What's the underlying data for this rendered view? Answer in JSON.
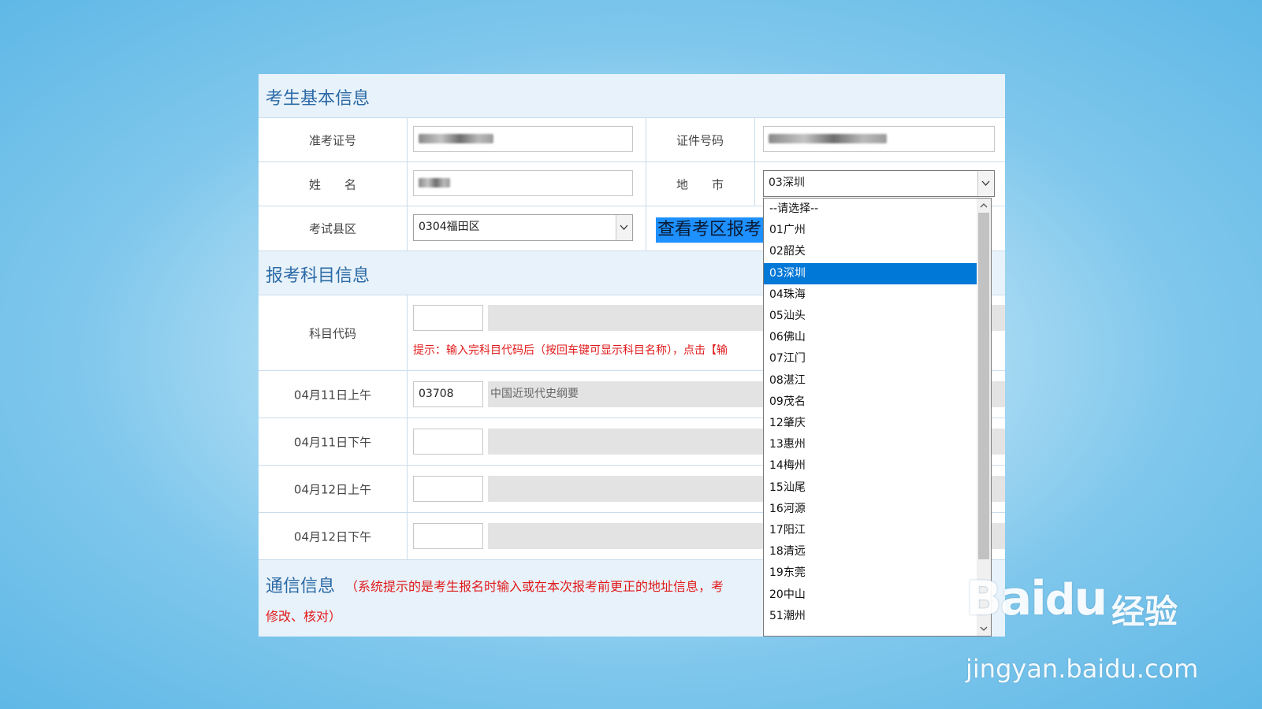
{
  "sections": {
    "basic_info_title": "考生基本信息",
    "subject_info_title": "报考科目信息",
    "contact_info_title": "通信信息",
    "contact_note_line1": "（系统提示的是考生报名时输入或在本次报考前更正的地址信息，考",
    "contact_note_line2": "修改、核对）"
  },
  "basic": {
    "admission_label": "准考证号",
    "id_label": "证件号码",
    "name_label": "姓　　名",
    "city_label": "地　　市",
    "city_value": "03深圳",
    "district_label": "考试县区",
    "district_value": "0304福田区",
    "view_button": "查看考区报考"
  },
  "subjects": {
    "code_label": "科目代码",
    "hint": "提示：输入完科目代码后（按回车键可显示科目名称），点击【输",
    "rows": [
      {
        "label": "04月11日上午",
        "code": "03708",
        "name": "中国近现代史纲要"
      },
      {
        "label": "04月11日下午",
        "code": "",
        "name": ""
      },
      {
        "label": "04月12日上午",
        "code": "",
        "name": ""
      },
      {
        "label": "04月12日下午",
        "code": "",
        "name": ""
      }
    ]
  },
  "city_dropdown": {
    "selected_index": 3,
    "options": [
      "--请选择--",
      "01广州",
      "02韶关",
      "03深圳",
      "04珠海",
      "05汕头",
      "06佛山",
      "07江门",
      "08湛江",
      "09茂名",
      "12肇庆",
      "13惠州",
      "14梅州",
      "15汕尾",
      "16河源",
      "17阳江",
      "18清远",
      "19东莞",
      "20中山",
      "51潮州"
    ]
  },
  "watermark": {
    "logo": "Baidu经验",
    "url": "jingyan.baidu.com"
  },
  "colors": {
    "section_bg": "#e8f2fa",
    "section_title": "#2b6aa6",
    "hint_red": "#e01b1b",
    "selected_option": "#0078d7",
    "button_blue": "#1e90ff"
  }
}
